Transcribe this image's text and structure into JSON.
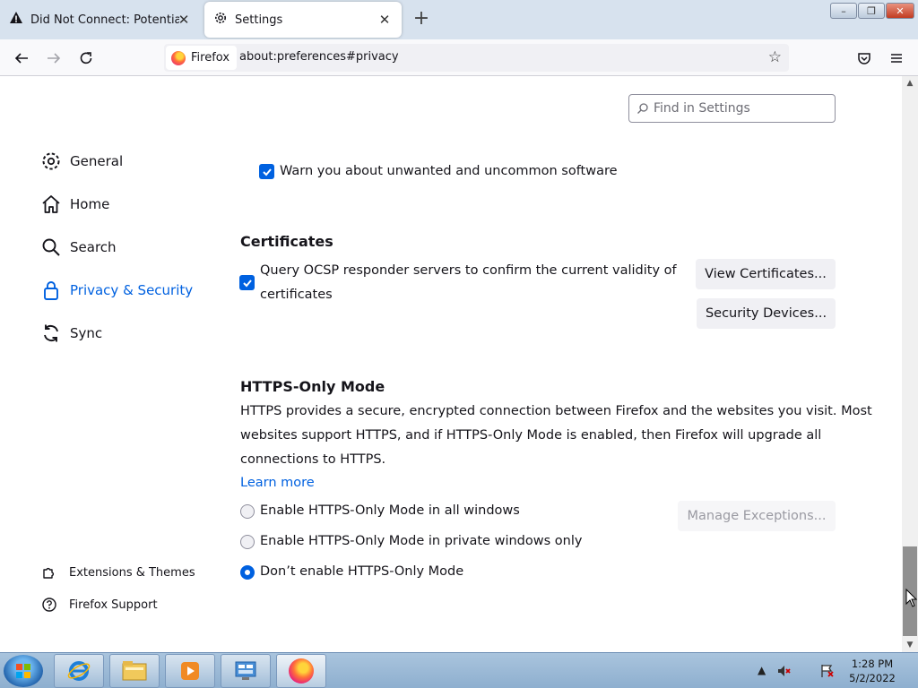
{
  "tabs": [
    {
      "title": "Did Not Connect: Potential Security Issue",
      "icon": "warning-icon",
      "active": false
    },
    {
      "title": "Settings",
      "icon": "gear-icon",
      "active": true
    }
  ],
  "window_controls": {
    "minimize": "–",
    "maximize": "❐",
    "close": "✕"
  },
  "navbar": {
    "identity_label": "Firefox",
    "url": "about:preferences#privacy"
  },
  "find": {
    "placeholder": "Find in Settings"
  },
  "sidebar": {
    "items": [
      {
        "label": "General",
        "icon": "gear-icon"
      },
      {
        "label": "Home",
        "icon": "home-icon"
      },
      {
        "label": "Search",
        "icon": "search-icon"
      },
      {
        "label": "Privacy & Security",
        "icon": "lock-icon",
        "selected": true
      },
      {
        "label": "Sync",
        "icon": "sync-icon"
      }
    ],
    "footer": [
      {
        "label": "Extensions & Themes",
        "icon": "puzzle-icon"
      },
      {
        "label": "Firefox Support",
        "icon": "help-icon"
      }
    ]
  },
  "security": {
    "warn_unwanted": "Warn you about unwanted and uncommon software"
  },
  "certificates": {
    "heading": "Certificates",
    "ocsp_line1": "Query OCSP responder servers to confirm the current validity of",
    "ocsp_line2": "certificates",
    "view_certificates": "View Certificates...",
    "security_devices": "Security Devices..."
  },
  "https_only": {
    "heading": "HTTPS-Only Mode",
    "desc_line1": "HTTPS provides a secure, encrypted connection between Firefox and the websites you visit. Most",
    "desc_line2": "websites support HTTPS, and if HTTPS-Only Mode is enabled, then Firefox will upgrade all",
    "desc_line3": "connections to HTTPS.",
    "learn_more": "Learn more",
    "options": [
      {
        "label": "Enable HTTPS-Only Mode in all windows",
        "checked": false
      },
      {
        "label": "Enable HTTPS-Only Mode in private windows only",
        "checked": false
      },
      {
        "label": "Don’t enable HTTPS-Only Mode",
        "checked": true
      }
    ],
    "manage_exceptions": "Manage Exceptions..."
  },
  "taskbar": {
    "apps": [
      "internet-explorer-icon",
      "file-explorer-icon",
      "media-player-icon",
      "control-panel-icon",
      "firefox-icon"
    ],
    "clock_time": "1:28 PM",
    "clock_date": "5/2/2022"
  },
  "colors": {
    "accent": "#0061e0",
    "text": "#15141a"
  }
}
